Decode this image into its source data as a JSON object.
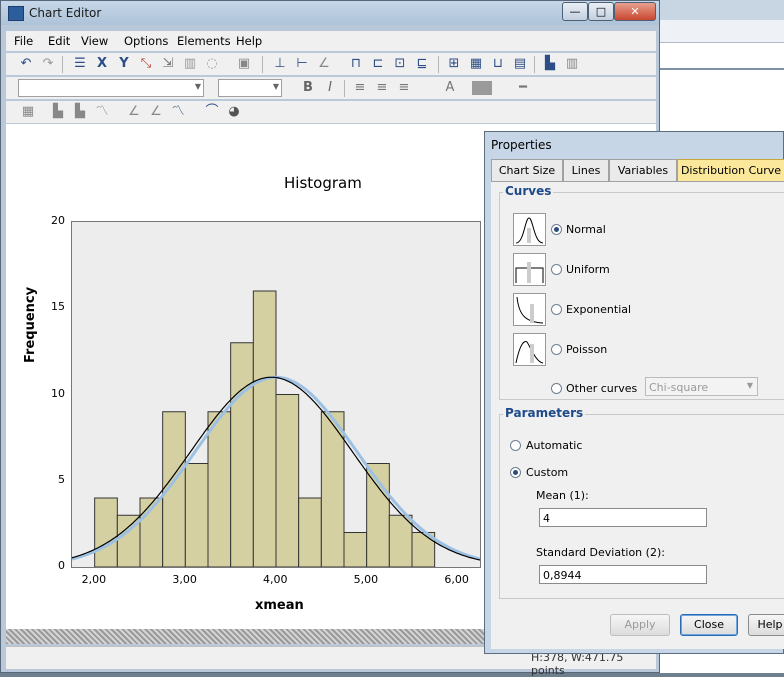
{
  "editor": {
    "title": "Chart Editor",
    "window_controls": {
      "minimize": "—",
      "maximize": "□",
      "close": "✕"
    },
    "menu": [
      "File",
      "Edit",
      "View",
      "Options",
      "Elements",
      "Help"
    ],
    "status": "H:378, W:471.75 points"
  },
  "chart": {
    "title": "Histogram",
    "xlabel": "xmean",
    "ylabel": "Frequency",
    "y_ticks": [
      "0",
      "5",
      "10",
      "15",
      "20"
    ],
    "x_ticks": [
      "2,00",
      "3,00",
      "4,00",
      "5,00",
      "6,00"
    ]
  },
  "chart_data": {
    "type": "bar",
    "title": "Histogram",
    "xlabel": "xmean",
    "ylabel": "Frequency",
    "xlim": [
      1.75,
      6.25
    ],
    "ylim": [
      0,
      20
    ],
    "bin_width": 0.25,
    "bin_starts": [
      2.0,
      2.25,
      2.5,
      2.75,
      3.0,
      3.25,
      3.5,
      3.75,
      4.0,
      4.25,
      4.5,
      4.75,
      5.0,
      5.25,
      5.5
    ],
    "values": [
      4,
      3,
      4,
      9,
      6,
      9,
      13,
      16,
      10,
      4,
      9,
      2,
      6,
      3,
      2
    ],
    "bar_color": "#d5d0a2",
    "curves": [
      {
        "type": "normal",
        "mean": 4,
        "sd": 0.8944,
        "peak": 11,
        "color": "#9cc1e4"
      },
      {
        "type": "normal",
        "mean": 3.95,
        "sd": 0.8944,
        "peak": 11,
        "color": "#000000"
      }
    ]
  },
  "properties": {
    "title": "Properties",
    "tabs": [
      "Chart Size",
      "Lines",
      "Variables",
      "Distribution Curve"
    ],
    "active_tab": "Distribution Curve",
    "curves_group": "Curves",
    "curve_options": [
      "Normal",
      "Uniform",
      "Exponential",
      "Poisson",
      "Other curves"
    ],
    "selected_curve": "Normal",
    "other_curves_select": "Chi-square",
    "parameters_group": "Parameters",
    "param_modes": [
      "Automatic",
      "Custom"
    ],
    "selected_mode": "Custom",
    "mean_label": "Mean (1):",
    "mean_value": "4",
    "sd_label": "Standard Deviation (2):",
    "sd_value": "0,8944",
    "buttons": {
      "apply": "Apply",
      "close": "Close",
      "help": "Help"
    },
    "accent": "#fbe89b"
  }
}
